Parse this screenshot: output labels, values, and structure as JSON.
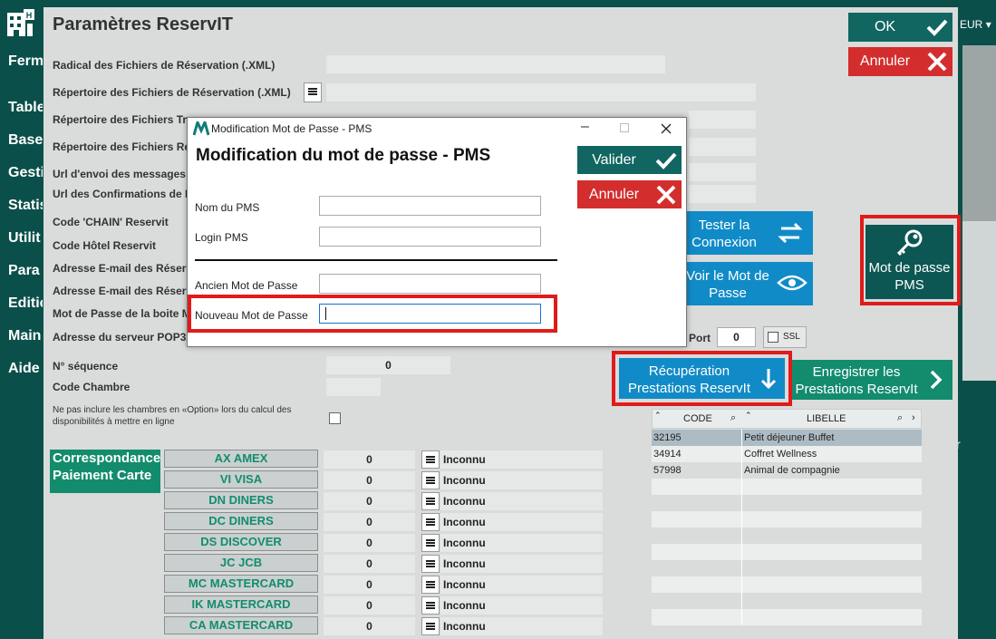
{
  "sidebar": {
    "items": [
      "Ferm",
      "Table",
      "Base",
      "Gesti",
      "Statis",
      "Utilit",
      "Para",
      "Editio",
      "Main",
      "Aide"
    ]
  },
  "right_strip": {
    "currency": "EUR",
    "r_text": "r"
  },
  "page": {
    "title": "Paramètres ReservIT"
  },
  "toolbar": {
    "ok_label": "OK",
    "cancel_label": "Annuler"
  },
  "form": {
    "labels": {
      "radical": "Radical des Fichiers de Réservation (.XML)",
      "repertoire": "Répertoire des Fichiers de Réservation (.XML)",
      "rep_traites": "Répertoire des Fichiers Tr",
      "rep_rejetes": "Répertoire des Fichiers Ré",
      "url_envoi": "Url d'envoi des messages",
      "url_conf": "Url des Confirmations de F",
      "code_chain": "Code 'CHAIN' Reservit",
      "code_hotel": "Code Hôtel Reservit",
      "email1": "Adresse E-mail des Réser",
      "email2": "Adresse E-mail des Réser",
      "mdp_boite": "Mot de Passe de la boite M",
      "pop3": "Adresse du serveur POP3",
      "sequence": "N° séquence",
      "code_chambre": "Code Chambre",
      "option_note": "Ne pas inclure les chambres en «Option» lors du calcul des disponibilités à mettre en ligne"
    },
    "sequence_value": "0",
    "port_label": "Port",
    "port_value": "0",
    "ssl_label": "SSL"
  },
  "buttons": {
    "tester": "Tester la Connexion",
    "voir_mdp": "Voir le Mot de Passe",
    "mot_de_passe_pms": "Mot de passe PMS",
    "recuperation": "Récupération Prestations ReservIt",
    "enregistrer": "Enregistrer les Prestations ReservIt"
  },
  "prestations_table": {
    "columns": [
      "CODE",
      "LIBELLE"
    ],
    "rows": [
      {
        "code": "32195",
        "libelle": "Petit déjeuner Buffet"
      },
      {
        "code": "34914",
        "libelle": "Coffret Wellness"
      },
      {
        "code": "57998",
        "libelle": "Animal de compagnie"
      }
    ]
  },
  "correspondance": {
    "title": "Correspondance Paiement Carte",
    "rows": [
      {
        "code": "AX  AMEX",
        "value": "0",
        "label": "Inconnu"
      },
      {
        "code": "VI  VISA",
        "value": "0",
        "label": "Inconnu"
      },
      {
        "code": "DN  DINERS",
        "value": "0",
        "label": "Inconnu"
      },
      {
        "code": "DC  DINERS",
        "value": "0",
        "label": "Inconnu"
      },
      {
        "code": "DS  DISCOVER",
        "value": "0",
        "label": "Inconnu"
      },
      {
        "code": "JC  JCB",
        "value": "0",
        "label": "Inconnu"
      },
      {
        "code": "MC  MASTERCARD",
        "value": "0",
        "label": "Inconnu"
      },
      {
        "code": "IK  MASTERCARD",
        "value": "0",
        "label": "Inconnu"
      },
      {
        "code": "CA  MASTERCARD",
        "value": "0",
        "label": "Inconnu"
      }
    ]
  },
  "dialog": {
    "window_title": "Modification Mot de Passe - PMS",
    "heading": "Modification du mot de passe - PMS",
    "valider": "Valider",
    "annuler": "Annuler",
    "nom_pms": "Nom du PMS",
    "login_pms": "Login PMS",
    "ancien_mdp": "Ancien Mot de Passe",
    "nouveau_mdp": "Nouveau Mot de Passe",
    "nom_value": "",
    "login_value": "",
    "ancien_value": "",
    "nouveau_value": ""
  },
  "colors": {
    "teal_dark": "#0b4f4a",
    "teal_btn": "#116661",
    "red": "#d32d2d",
    "blue": "#118bc7",
    "green": "#138c6e",
    "highlight": "#e01b1b"
  }
}
